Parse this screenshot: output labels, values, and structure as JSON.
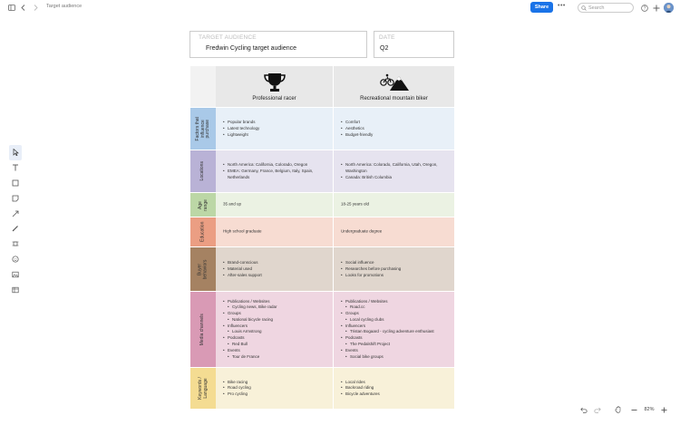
{
  "window": {
    "doc_title": "Target audience",
    "share_label": "Share",
    "more_label": "•••",
    "search_placeholder": "Search",
    "zoom": "82%"
  },
  "header": {
    "target_label": "TARGET AUDIENCE",
    "target_value": "Fredwin Cycling target audience",
    "date_label": "DATE",
    "date_value": "Q2"
  },
  "columns": [
    {
      "name": "Professional racer",
      "icon": "trophy-icon"
    },
    {
      "name": "Recreational mountain biker",
      "icon": "mountain-bike-icon"
    }
  ],
  "rows": [
    {
      "label": "Factors that influence purchase",
      "label_lines": [
        "Factors that",
        "influence",
        "purchase"
      ],
      "color": "#a9c9e8",
      "bg": "#e8f0f8",
      "col1": [
        {
          "t": "Popular brands"
        },
        {
          "t": "Latest technology"
        },
        {
          "t": "Lightweight"
        }
      ],
      "col2": [
        {
          "t": "Comfort"
        },
        {
          "t": "Aesthetics"
        },
        {
          "t": "Budget-friendly"
        }
      ]
    },
    {
      "label": "Locations",
      "label_lines": [
        "Locations"
      ],
      "color": "#b9b2d6",
      "bg": "#e6e3ef",
      "col1": [
        {
          "t": "North America: California, Colorado, Oregon"
        },
        {
          "t": "EMEA: Germany, France, Belgium, Italy, Spain, Netherlands"
        }
      ],
      "col2": [
        {
          "t": "North America: Colorado, California, Utah, Oregon, Washington"
        },
        {
          "t": "Canada: British Columbia"
        }
      ]
    },
    {
      "label": "Age range",
      "label_lines": [
        "Age",
        "range"
      ],
      "color": "#bcd7a6",
      "bg": "#ebf2e3",
      "col1_plain": "35 and up",
      "col2_plain": "18-25 years old"
    },
    {
      "label": "Education",
      "label_lines": [
        "Education"
      ],
      "color": "#eb9e83",
      "bg": "#f7dcd2",
      "col1_plain": "High school graduate",
      "col2_plain": "Undergraduate degree"
    },
    {
      "label": "Buyer behaviors",
      "label_lines": [
        "Buyer",
        "behaviors"
      ],
      "color": "#a58262",
      "bg": "#e0d6cd",
      "col1": [
        {
          "t": "Brand-conscious"
        },
        {
          "t": "Material used"
        },
        {
          "t": "After-sales support"
        }
      ],
      "col2": [
        {
          "t": "Social influence"
        },
        {
          "t": "Researches before purchasing"
        },
        {
          "t": "Looks for promotions"
        }
      ]
    },
    {
      "label": "Media channels",
      "label_lines": [
        "Media channels"
      ],
      "color": "#d99ab5",
      "bg": "#efd6e1",
      "col1": [
        {
          "t": "Publications / Websites"
        },
        {
          "t": "Cycling news, Bike radar",
          "sub": true
        },
        {
          "t": "Groups"
        },
        {
          "t": "National bicycle racing",
          "sub": true
        },
        {
          "t": "Influencers"
        },
        {
          "t": "Louis Armstrong",
          "sub": true
        },
        {
          "t": "Podcasts"
        },
        {
          "t": "Red Bull",
          "sub": true
        },
        {
          "t": "Events"
        },
        {
          "t": "Tour de France",
          "sub": true
        }
      ],
      "col2": [
        {
          "t": "Publications / Websites"
        },
        {
          "t": "Road.cc",
          "sub": true
        },
        {
          "t": "Groups"
        },
        {
          "t": "Local cycling clubs",
          "sub": true
        },
        {
          "t": "Influencers"
        },
        {
          "t": "Tristan Bogaard - cycling adventure enthusiast",
          "sub": true
        },
        {
          "t": "Podcasts"
        },
        {
          "t": "The Pedalshift Project",
          "sub": true
        },
        {
          "t": "Events"
        },
        {
          "t": "Social bike groups",
          "sub": true
        }
      ]
    },
    {
      "label": "Keywords / Language",
      "label_lines": [
        "Keywords /",
        "Language"
      ],
      "color": "#f4dc92",
      "bg": "#f8f1d9",
      "col1": [
        {
          "t": "Bike racing"
        },
        {
          "t": "Road cycling"
        },
        {
          "t": "Pro cycling"
        }
      ],
      "col2": [
        {
          "t": "Local rides"
        },
        {
          "t": "Backroad riding"
        },
        {
          "t": "Bicycle adventures"
        }
      ]
    }
  ],
  "tools": [
    "pointer-tool-icon",
    "text-tool-icon",
    "shape-tool-icon",
    "sticky-note-tool-icon",
    "line-tool-icon",
    "pen-tool-icon",
    "frame-tool-icon",
    "emoji-tool-icon",
    "image-tool-icon",
    "table-tool-icon"
  ]
}
